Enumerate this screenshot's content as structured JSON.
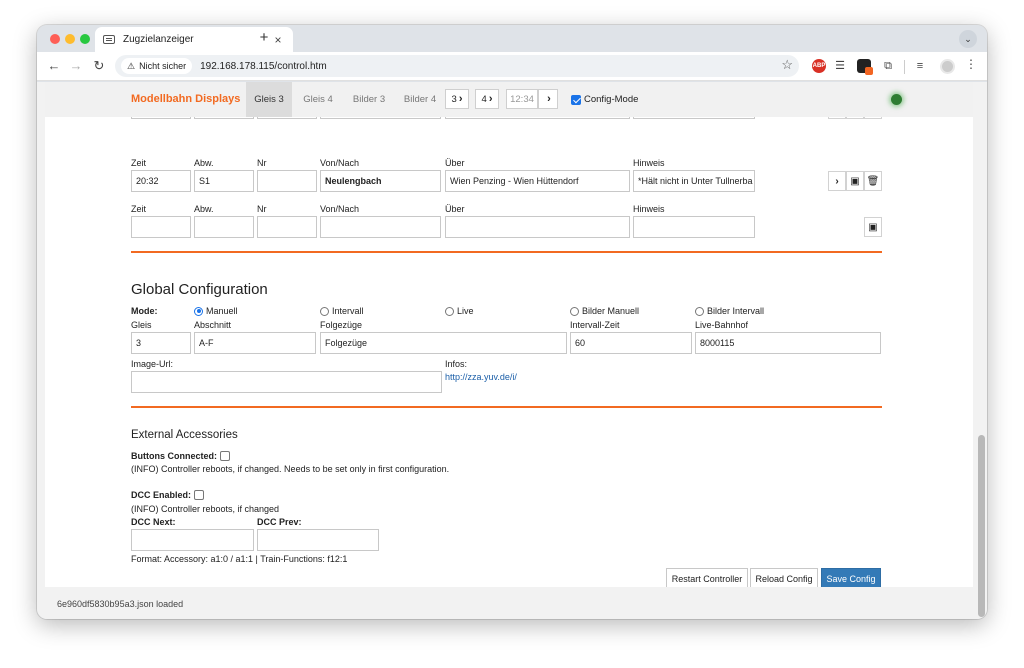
{
  "browser": {
    "tab_title": "Zugzielanzeiger",
    "tab_close": "×",
    "new_tab": "+",
    "security_label": "Nicht sicher",
    "url": "192.168.178.115/control.htm",
    "ext_abp": "ABP"
  },
  "nav": {
    "brand": "Modellbahn Displays",
    "tabs": [
      "Gleis 3",
      "Gleis 4",
      "Bilder 3",
      "Bilder 4"
    ],
    "page3": "3",
    "page4": "4",
    "time": "12:34",
    "config_mode": "Config-Mode"
  },
  "rows": {
    "labels": {
      "zeit": "Zeit",
      "abw": "Abw.",
      "nr": "Nr",
      "von_nach": "Von/Nach",
      "ueber": "Über",
      "hinweis": "Hinweis"
    },
    "row1": {
      "zeit": "20:32",
      "abw": "S1",
      "nr": "",
      "von_nach": "Neulengbach",
      "ueber": "Wien Penzing - Wien Hüttendorf",
      "hinweis": "*Hält nicht in Unter Tullnerba"
    },
    "row2": {
      "zeit": "",
      "abw": "",
      "nr": "",
      "von_nach": "",
      "ueber": "",
      "hinweis": ""
    }
  },
  "global": {
    "heading": "Global Configuration",
    "mode_label": "Mode:",
    "modes": [
      "Manuell",
      "Intervall",
      "Live",
      "Bilder Manuell",
      "Bilder Intervall"
    ],
    "selected_mode": "Manuell",
    "labels": {
      "gleis": "Gleis",
      "abschnitt": "Abschnitt",
      "folgezuege": "Folgezüge",
      "intervall_zeit": "Intervall-Zeit",
      "live_bahnhof": "Live-Bahnhof",
      "image_url": "Image-Url:",
      "infos": "Infos:"
    },
    "values": {
      "gleis": "3",
      "abschnitt": "A-F",
      "folgezuege": "Folgezüge",
      "intervall_zeit": "60",
      "live_bahnhof": "8000115",
      "image_url": ""
    },
    "infos_link": "http://zza.yuv.de/i/"
  },
  "external": {
    "heading": "External Accessories",
    "buttons_connected_label": "Buttons Connected:",
    "buttons_info": "(INFO) Controller reboots, if changed. Needs to be set only in first configuration.",
    "dcc_enabled_label": "DCC Enabled:",
    "dcc_info": "(INFO) Controller reboots, if changed",
    "dcc_next_label": "DCC Next:",
    "dcc_prev_label": "DCC Prev:",
    "dcc_next": "",
    "dcc_prev": "",
    "format_info": "Format: Accessory: a1:0 / a1:1 | Train-Functions: f12:1"
  },
  "actions": {
    "restart": "Restart Controller",
    "reload": "Reload Config",
    "save": "Save Config"
  },
  "status": "6e960df5830b95a3.json loaded"
}
